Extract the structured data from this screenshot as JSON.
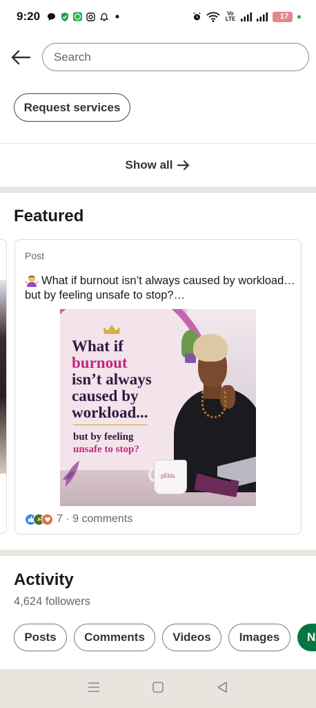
{
  "status_bar": {
    "time": "9:20",
    "battery": "17",
    "battery_level": 0.17,
    "network": "Vo LTE",
    "icons": [
      "chat-icon",
      "shield-icon",
      "whatsapp-icon",
      "instagram-icon",
      "bell-icon",
      "dot-icon",
      "alarm-icon",
      "wifi-icon",
      "signal-icon",
      "signal-icon",
      "battery-icon"
    ]
  },
  "header": {
    "back_icon": "back-arrow-icon",
    "search_placeholder": "Search"
  },
  "profile_actions": {
    "request_services": "Request services"
  },
  "services": {
    "show_all": "Show all",
    "show_all_icon": "arrow-right-icon"
  },
  "featured": {
    "title": "Featured",
    "post": {
      "type": "Post",
      "emoji": "woman-shrugging-emoji",
      "text": "What if burnout isn’t always caused by workload… but by feeling unsafe to stop?…",
      "image": {
        "headline_1": "What if",
        "headline_2": "burnout",
        "headline_3": "isn’t always",
        "headline_4": "caused by",
        "headline_5": "workload...",
        "sub_1": "but by feeling",
        "sub_2": "unsafe to stop?",
        "mug_label": "pEbis"
      },
      "reaction_icons": [
        "like-icon",
        "celebrate-icon",
        "love-icon"
      ],
      "reactions_count": "7",
      "comments": "9 comments"
    }
  },
  "activity": {
    "title": "Activity",
    "followers": "4,624 followers",
    "filters": [
      "Posts",
      "Comments",
      "Videos",
      "Images"
    ],
    "extra_filter_initial": "N"
  },
  "nav_bar": {
    "icons": [
      "menu-icon",
      "home-square-icon",
      "back-triangle-icon"
    ]
  },
  "colors": {
    "accent_green": "#057642",
    "band": "#e8e5df",
    "text_primary": "#191919",
    "text_secondary": "#666666"
  }
}
